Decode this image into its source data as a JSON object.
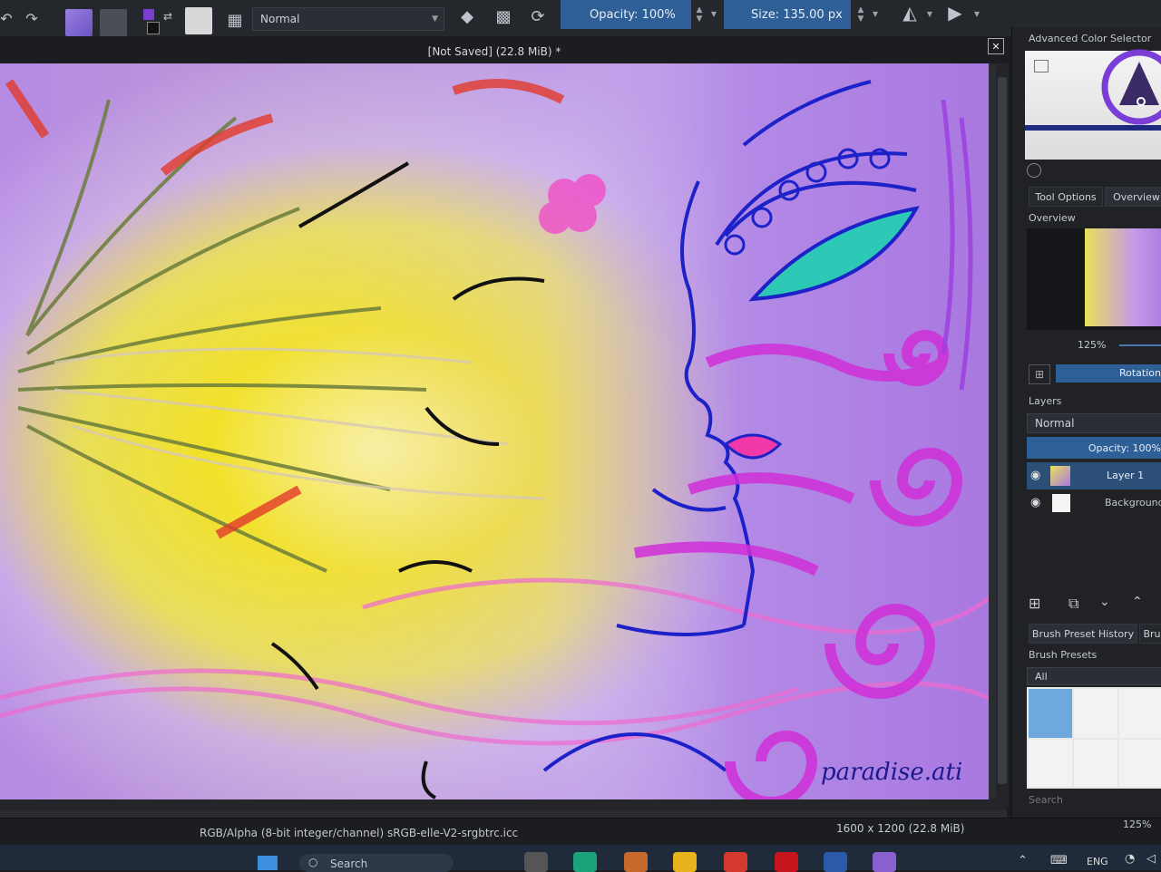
{
  "toolbar": {
    "blend_mode": "Normal",
    "opacity_label": "Opacity: 100%",
    "size_label": "Size: 135.00 px",
    "colors": {
      "foreground": "#7a3ed6",
      "background": "#222222",
      "gradient": "#8a6fd0",
      "pattern": "#555a61"
    }
  },
  "document": {
    "title": "[Not Saved]  (22.8 MiB) *",
    "watermark": "paradise.ati"
  },
  "docker": {
    "color_selector_title": "Advanced Color Selector",
    "tabs": [
      "Tool Options",
      "Overview"
    ],
    "overview_title": "Overview",
    "zoom": "125%",
    "rotation_label": "Rotation",
    "layers_title": "Layers",
    "layers_blend": "Normal",
    "layers_opacity": "Opacity:  100%",
    "layers": [
      {
        "name": "Layer 1",
        "selected": true
      },
      {
        "name": "Background",
        "selected": false
      }
    ],
    "brush_tabs": [
      "Brush Preset History",
      "Bru"
    ],
    "brush_presets_title": "Brush Presets",
    "brush_filter": "All",
    "search_placeholder": "Search"
  },
  "status": {
    "color_profile": "RGB/Alpha (8-bit integer/channel)  sRGB-elle-V2-srgbtrc.icc",
    "dimensions": "1600 x 1200 (22.8 MiB)",
    "zoom": "125%"
  },
  "taskbar": {
    "search_placeholder": "Search",
    "language": "ENG"
  }
}
